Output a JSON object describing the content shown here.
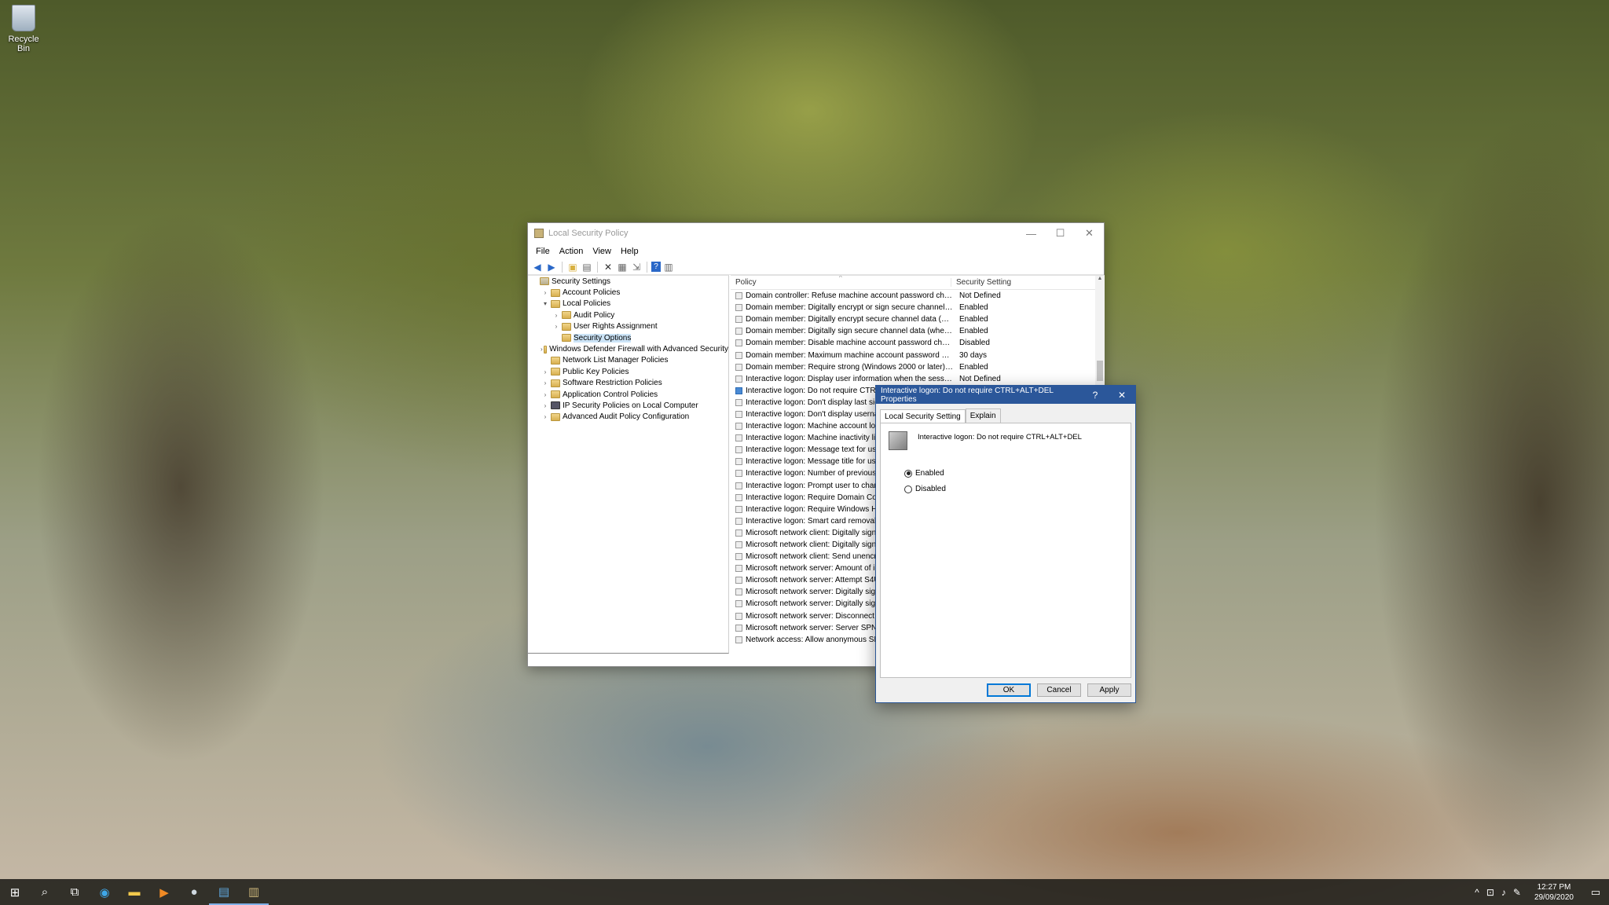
{
  "desktop": {
    "recycle_bin_label": "Recycle Bin"
  },
  "window": {
    "title": "Local Security Policy",
    "menu": [
      "File",
      "Action",
      "View",
      "Help"
    ],
    "tree": [
      {
        "label": "Security Settings",
        "indent": 0,
        "arrow": "",
        "icon": "sec"
      },
      {
        "label": "Account Policies",
        "indent": 1,
        "arrow": ">",
        "icon": "folder"
      },
      {
        "label": "Local Policies",
        "indent": 1,
        "arrow": "v",
        "icon": "folder"
      },
      {
        "label": "Audit Policy",
        "indent": 2,
        "arrow": ">",
        "icon": "folder"
      },
      {
        "label": "User Rights Assignment",
        "indent": 2,
        "arrow": ">",
        "icon": "folder"
      },
      {
        "label": "Security Options",
        "indent": 2,
        "arrow": "",
        "icon": "folder",
        "selected": true
      },
      {
        "label": "Windows Defender Firewall with Advanced Security",
        "indent": 1,
        "arrow": ">",
        "icon": "folder"
      },
      {
        "label": "Network List Manager Policies",
        "indent": 1,
        "arrow": "",
        "icon": "folder"
      },
      {
        "label": "Public Key Policies",
        "indent": 1,
        "arrow": ">",
        "icon": "folder"
      },
      {
        "label": "Software Restriction Policies",
        "indent": 1,
        "arrow": ">",
        "icon": "folder"
      },
      {
        "label": "Application Control Policies",
        "indent": 1,
        "arrow": ">",
        "icon": "folder"
      },
      {
        "label": "IP Security Policies on Local Computer",
        "indent": 1,
        "arrow": ">",
        "icon": "ip"
      },
      {
        "label": "Advanced Audit Policy Configuration",
        "indent": 1,
        "arrow": ">",
        "icon": "folder"
      }
    ],
    "list_headers": {
      "policy": "Policy",
      "setting": "Security Setting"
    },
    "rows": [
      {
        "policy": "Domain controller: Refuse machine account password chan...",
        "setting": "Not Defined"
      },
      {
        "policy": "Domain member: Digitally encrypt or sign secure channel d...",
        "setting": "Enabled"
      },
      {
        "policy": "Domain member: Digitally encrypt secure channel data (wh...",
        "setting": "Enabled"
      },
      {
        "policy": "Domain member: Digitally sign secure channel data (when ...",
        "setting": "Enabled"
      },
      {
        "policy": "Domain member: Disable machine account password chan...",
        "setting": "Disabled"
      },
      {
        "policy": "Domain member: Maximum machine account password age",
        "setting": "30 days"
      },
      {
        "policy": "Domain member: Require strong (Windows 2000 or later) se...",
        "setting": "Enabled"
      },
      {
        "policy": "Interactive logon: Display user information when the session...",
        "setting": "Not Defined"
      },
      {
        "policy": "Interactive logon: Do not require CTRL+",
        "setting": "",
        "selected": true
      },
      {
        "policy": "Interactive logon: Don't display last sign",
        "setting": ""
      },
      {
        "policy": "Interactive logon: Don't display usernan",
        "setting": ""
      },
      {
        "policy": "Interactive logon: Machine account loc",
        "setting": ""
      },
      {
        "policy": "Interactive logon: Machine inactivity lin",
        "setting": ""
      },
      {
        "policy": "Interactive logon: Message text for user",
        "setting": ""
      },
      {
        "policy": "Interactive logon: Message title for user",
        "setting": ""
      },
      {
        "policy": "Interactive logon: Number of previous l",
        "setting": ""
      },
      {
        "policy": "Interactive logon: Prompt user to chang",
        "setting": ""
      },
      {
        "policy": "Interactive logon: Require Domain Con",
        "setting": ""
      },
      {
        "policy": "Interactive logon: Require Windows He",
        "setting": ""
      },
      {
        "policy": "Interactive logon: Smart card removal b",
        "setting": ""
      },
      {
        "policy": "Microsoft network client: Digitally sign",
        "setting": ""
      },
      {
        "policy": "Microsoft network client: Digitally sign",
        "setting": ""
      },
      {
        "policy": "Microsoft network client: Send unencry",
        "setting": ""
      },
      {
        "policy": "Microsoft network server: Amount of id",
        "setting": ""
      },
      {
        "policy": "Microsoft network server: Attempt S4U2",
        "setting": ""
      },
      {
        "policy": "Microsoft network server: Digitally sign",
        "setting": ""
      },
      {
        "policy": "Microsoft network server: Digitally sign",
        "setting": ""
      },
      {
        "policy": "Microsoft network server: Disconnect c",
        "setting": ""
      },
      {
        "policy": "Microsoft network server: Server SPN ta",
        "setting": ""
      },
      {
        "policy": "Network access: Allow anonymous SID/",
        "setting": ""
      }
    ]
  },
  "dialog": {
    "title": "Interactive logon: Do not require CTRL+ALT+DEL Properties",
    "help_glyph": "?",
    "close_glyph": "✕",
    "tabs": [
      "Local Security Setting",
      "Explain"
    ],
    "policy_name": "Interactive logon: Do not require CTRL+ALT+DEL",
    "enabled_label": "Enabled",
    "disabled_label": "Disabled",
    "selected": "Enabled",
    "ok_label": "OK",
    "cancel_label": "Cancel",
    "apply_label": "Apply"
  },
  "taskbar": {
    "time": "12:27 PM",
    "date": "29/09/2020",
    "icons": [
      "start-icon",
      "search-icon",
      "task-view-icon",
      "edge-icon",
      "file-explorer-icon",
      "media-player-icon",
      "steam-icon",
      "control-panel-icon",
      "security-policy-icon"
    ]
  }
}
